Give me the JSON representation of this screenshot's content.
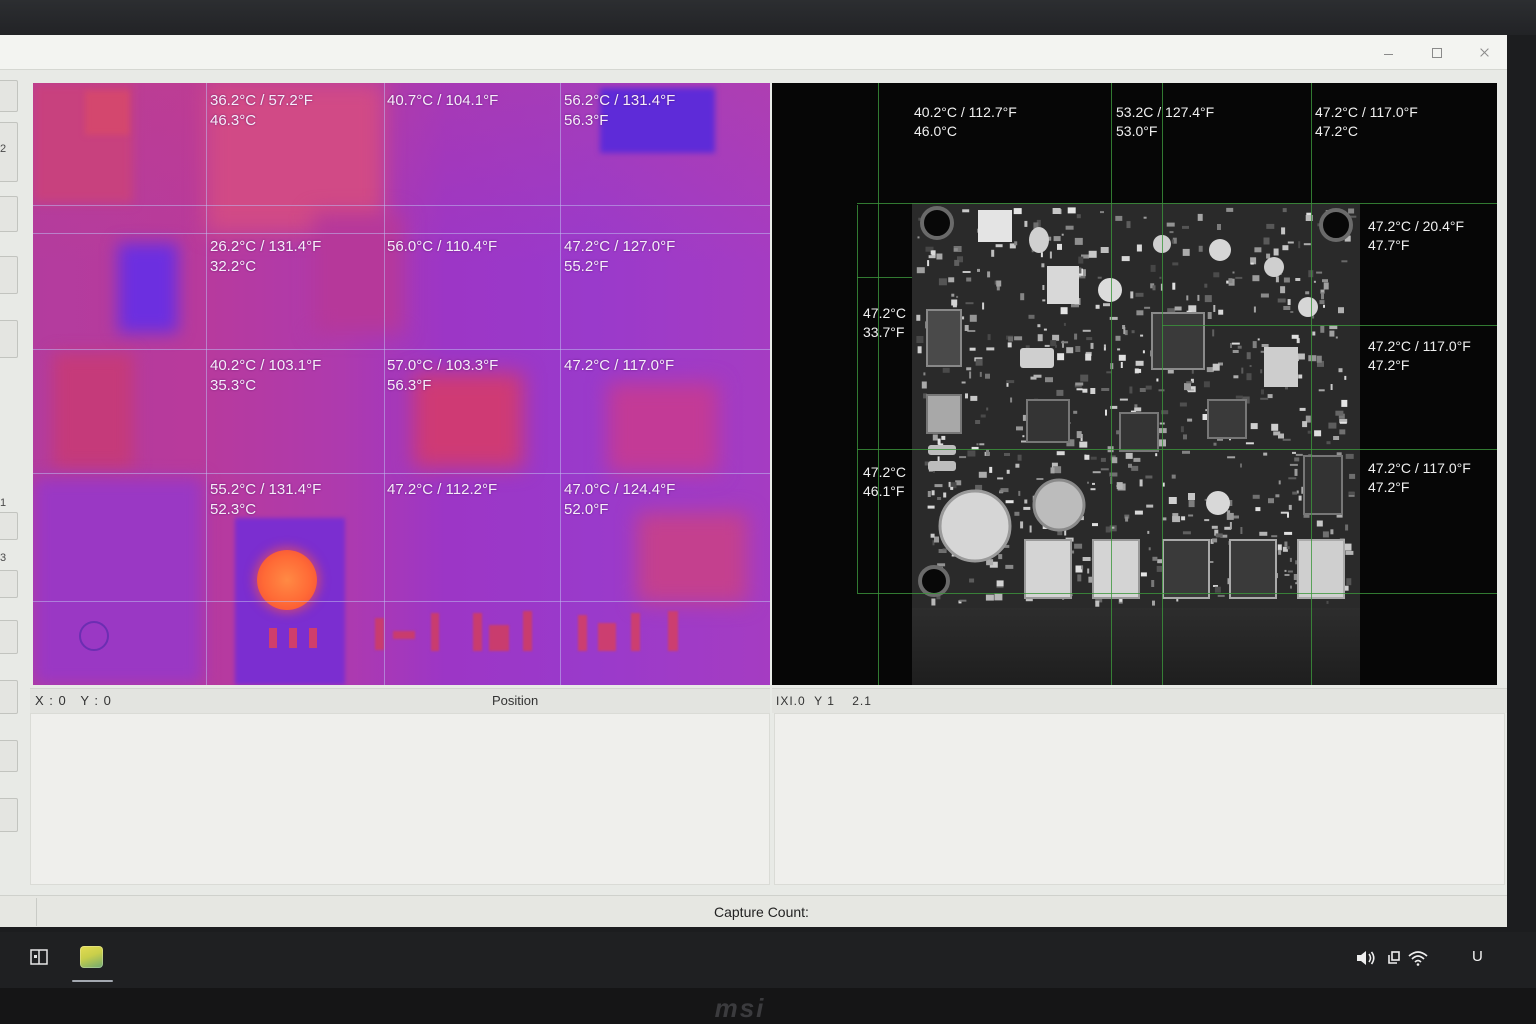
{
  "colors": {
    "window_bg": "#e8eae6",
    "thermal_grid": "#beb9ee",
    "visual_grid": "#3c963c",
    "reading_text": "#f6eefa",
    "taskbar_bg": "#1f2022",
    "app_icon": "#c9cf4a"
  },
  "window": {
    "controls": [
      "minimize-icon",
      "maximize-icon",
      "close-icon"
    ]
  },
  "sidebar": {
    "labels": [
      "2",
      "1",
      "3"
    ]
  },
  "thermal_view": {
    "readings": [
      {
        "temp": "36.2°C / 57.2°F",
        "sub": "46.3°C"
      },
      {
        "temp": "40.7°C / 104.1°F"
      },
      {
        "temp": "56.2°C / 131.4°F",
        "sub": "56.3°F"
      },
      {
        "temp": "26.2°C / 131.4°F",
        "sub": "32.2°C"
      },
      {
        "temp": "56.0°C / 110.4°F"
      },
      {
        "temp": "47.2°C / 127.0°F",
        "sub": "55.2°F"
      },
      {
        "temp": "40.2°C / 103.1°F",
        "sub": "35.3°C"
      },
      {
        "temp": "57.0°C / 103.3°F",
        "sub": "56.3°F"
      },
      {
        "temp": "47.2°C / 117.0°F"
      },
      {
        "temp": "55.2°C / 131.4°F",
        "sub": "52.3°C"
      },
      {
        "temp": "47.2°C / 112.2°F"
      },
      {
        "temp": "47.0°C / 124.4°F",
        "sub": "52.0°F"
      }
    ]
  },
  "visual_view": {
    "readings": [
      {
        "temp": "40.2°C / 112.7°F",
        "sub": "46.0°C"
      },
      {
        "temp": "53.2C / 127.4°F",
        "sub": "53.0°F"
      },
      {
        "temp": "47.2°C / 117.0°F",
        "sub": "47.2°C"
      },
      {
        "temp": "47.2°C / 20.4°F",
        "sub": "47.7°F"
      },
      {
        "temp": "47.2°C",
        "sub": "33.7°F"
      },
      {
        "temp": "47.2°C / 117.0°F",
        "sub": "47.2°F"
      },
      {
        "temp": "47.2°C",
        "sub": "46.1°F"
      },
      {
        "temp": "47.2°C / 117.0°F",
        "sub": "47.2°F"
      }
    ]
  },
  "status": {
    "thermal_coords": "X : 0   Y : 0",
    "position_label": "Position",
    "visual_coords": "IXI.0  Y 1    2.1"
  },
  "footer": {
    "capture_count_label": "Capture Count:"
  },
  "taskbar": {
    "left_icons": [
      "task-view-icon",
      "app-icon"
    ],
    "tray_icons": [
      "speaker-icon",
      "display-icon",
      "wifi-icon"
    ],
    "tray_text": "U"
  },
  "bezel": {
    "logo_text": "msi"
  }
}
